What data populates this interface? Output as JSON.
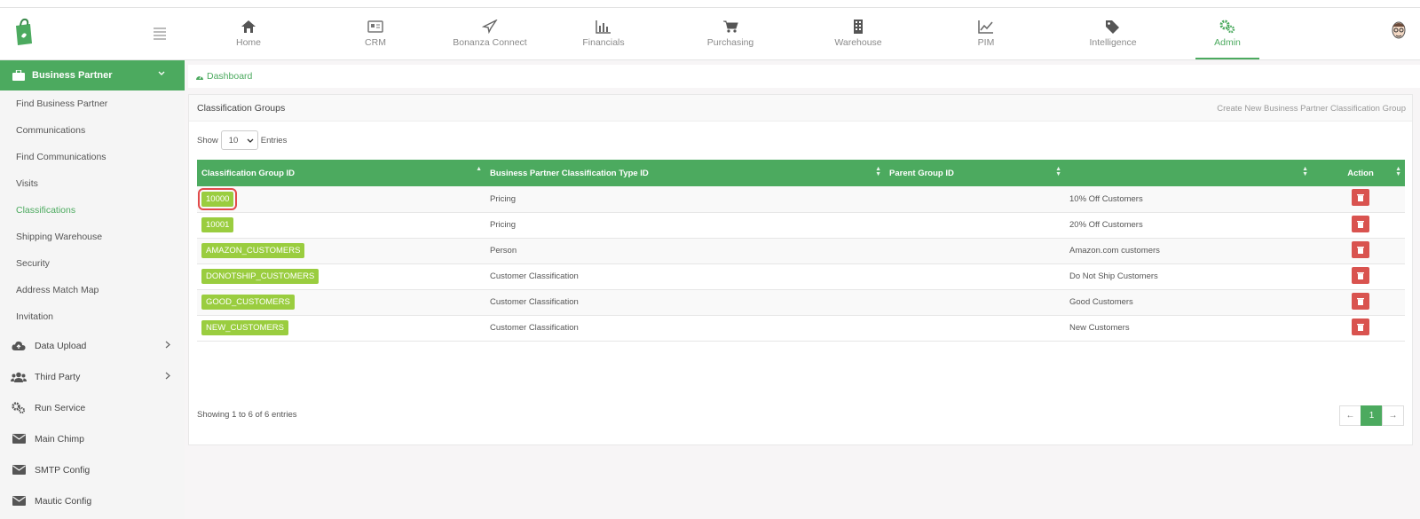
{
  "nav": {
    "items": [
      {
        "label": "Home",
        "icon": "home-icon"
      },
      {
        "label": "CRM",
        "icon": "crm-icon"
      },
      {
        "label": "Bonanza Connect",
        "icon": "paper-plane-icon"
      },
      {
        "label": "Financials",
        "icon": "bar-chart-icon"
      },
      {
        "label": "Purchasing",
        "icon": "cart-icon"
      },
      {
        "label": "Warehouse",
        "icon": "building-icon"
      },
      {
        "label": "PIM",
        "icon": "line-chart-icon"
      },
      {
        "label": "Intelligence",
        "icon": "tags-icon"
      },
      {
        "label": "Admin",
        "icon": "gears-icon"
      }
    ],
    "active": "Admin"
  },
  "sidebar": {
    "section": "Business Partner",
    "items": [
      {
        "label": "Find Business Partner"
      },
      {
        "label": "Communications"
      },
      {
        "label": "Find Communications"
      },
      {
        "label": "Visits"
      },
      {
        "label": "Classifications"
      },
      {
        "label": "Shipping Warehouse"
      },
      {
        "label": "Security"
      },
      {
        "label": "Address Match Map"
      },
      {
        "label": "Invitation"
      }
    ],
    "active": "Classifications",
    "groups": [
      {
        "label": "Data Upload",
        "icon": "cloud-upload-icon",
        "expandable": true
      },
      {
        "label": "Third Party",
        "icon": "users-icon",
        "expandable": true
      },
      {
        "label": "Run Service",
        "icon": "gears-icon",
        "expandable": false
      },
      {
        "label": "Main Chimp",
        "icon": "envelope-icon",
        "expandable": false
      },
      {
        "label": "SMTP Config",
        "icon": "envelope-icon",
        "expandable": false
      },
      {
        "label": "Mautic Config",
        "icon": "envelope-icon",
        "expandable": false
      }
    ]
  },
  "breadcrumb": {
    "label": "Dashboard"
  },
  "panel": {
    "title": "Classification Groups",
    "create_link": "Create New Business Partner Classification Group"
  },
  "length": {
    "show": "Show",
    "value": "10",
    "entries": "Entries"
  },
  "table": {
    "columns": [
      "Classification Group ID",
      "Business Partner Classification Type ID",
      "Parent Group ID",
      "",
      "Action"
    ],
    "rows": [
      {
        "id": "10000",
        "type": "Pricing",
        "parent": "",
        "description": "10% Off Customers"
      },
      {
        "id": "10001",
        "type": "Pricing",
        "parent": "",
        "description": "20% Off Customers"
      },
      {
        "id": "AMAZON_CUSTOMERS",
        "type": "Person",
        "parent": "",
        "description": "Amazon.com customers"
      },
      {
        "id": "DONOTSHIP_CUSTOMERS",
        "type": "Customer Classification",
        "parent": "",
        "description": "Do Not Ship Customers"
      },
      {
        "id": "GOOD_CUSTOMERS",
        "type": "Customer Classification",
        "parent": "",
        "description": "Good Customers"
      },
      {
        "id": "NEW_CUSTOMERS",
        "type": "Customer Classification",
        "parent": "",
        "description": "New Customers"
      }
    ]
  },
  "footer": {
    "info": "Showing 1 to 6 of 6 entries"
  },
  "pagination": {
    "prev": "←",
    "page": "1",
    "next": "→"
  },
  "colors": {
    "accent": "#4caa5f",
    "badge": "#9acd3f",
    "danger": "#d9534f"
  }
}
